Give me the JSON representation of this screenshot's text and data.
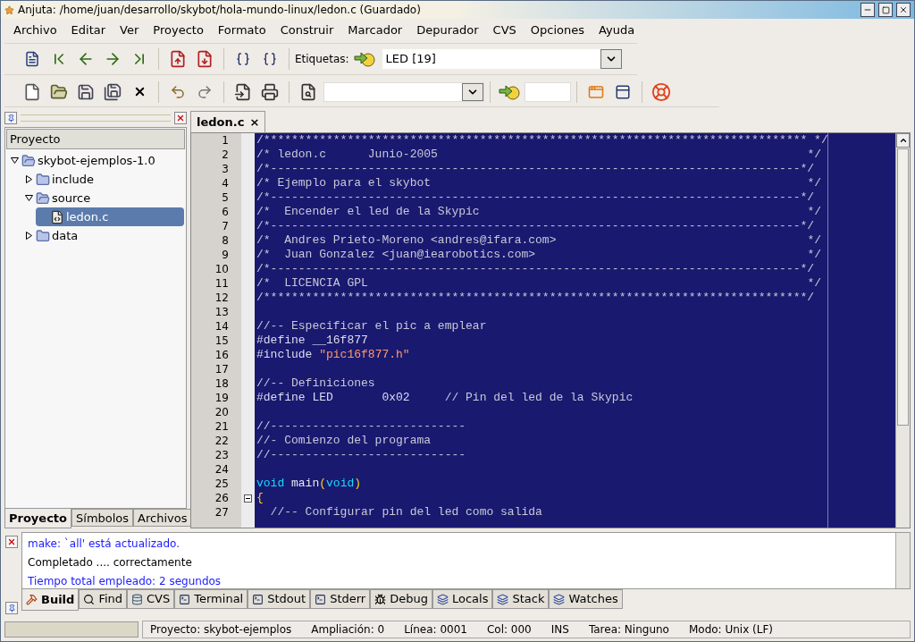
{
  "window": {
    "title": "Anjuta: /home/juan/desarrollo/skybot/hola-mundo-linux/ledon.c (Guardado)"
  },
  "menu": [
    "Archivo",
    "Editar",
    "Ver",
    "Proyecto",
    "Formato",
    "Construir",
    "Marcador",
    "Depurador",
    "CVS",
    "Opciones",
    "Ayuda"
  ],
  "tag_bar": {
    "label": "Etiquetas:",
    "value": "LED [19]"
  },
  "project_panel": {
    "header": "Proyecto",
    "tree": [
      {
        "label": "skybot-ejemplos-1.0",
        "kind": "folder",
        "expanded": true,
        "selected": false,
        "children": [
          {
            "label": "include",
            "kind": "folder",
            "expanded": false,
            "selected": false
          },
          {
            "label": "source",
            "kind": "folder",
            "expanded": true,
            "selected": false,
            "children": [
              {
                "label": "ledon.c",
                "kind": "file",
                "selected": true
              }
            ]
          },
          {
            "label": "data",
            "kind": "folder",
            "expanded": false,
            "selected": false
          }
        ]
      }
    ],
    "tabs": [
      {
        "label": "Proyecto",
        "selected": true
      },
      {
        "label": "Símbolos",
        "selected": false
      },
      {
        "label": "Archivos",
        "selected": false
      }
    ]
  },
  "editor": {
    "tabs": [
      {
        "label": "ledon.c",
        "close": "×",
        "selected": true
      }
    ],
    "lines": [
      {
        "num": "1",
        "tokens": [
          {
            "kind": "comment",
            "text": "/****************************************************************************** */"
          }
        ]
      },
      {
        "num": "2",
        "tokens": [
          {
            "kind": "comment",
            "text": "/* ledon.c      Junio-2005"
          }
        ],
        "end": "*/"
      },
      {
        "num": "3",
        "tokens": [
          {
            "kind": "comment",
            "text": "/*----------------------------------------------------------------------------*/"
          }
        ]
      },
      {
        "num": "4",
        "tokens": [
          {
            "kind": "comment",
            "text": "/* Ejemplo para el skybot"
          }
        ],
        "end": "*/"
      },
      {
        "num": "5",
        "tokens": [
          {
            "kind": "comment",
            "text": "/*----------------------------------------------------------------------------*/"
          }
        ]
      },
      {
        "num": "6",
        "tokens": [
          {
            "kind": "comment",
            "text": "/*  Encender el led de la Skypic"
          }
        ],
        "end": "*/"
      },
      {
        "num": "7",
        "tokens": [
          {
            "kind": "comment",
            "text": "/*----------------------------------------------------------------------------*/"
          }
        ]
      },
      {
        "num": "8",
        "tokens": [
          {
            "kind": "comment",
            "text": "/*  Andres Prieto-Moreno <andres@ifara.com>"
          }
        ],
        "end": "*/"
      },
      {
        "num": "9",
        "tokens": [
          {
            "kind": "comment",
            "text": "/*  Juan Gonzalez <juan@iearobotics.com>"
          }
        ],
        "end": "*/"
      },
      {
        "num": "10",
        "tokens": [
          {
            "kind": "comment",
            "text": "/*----------------------------------------------------------------------------*/"
          }
        ]
      },
      {
        "num": "11",
        "tokens": [
          {
            "kind": "comment",
            "text": "/*  LICENCIA GPL"
          }
        ],
        "end": "*/"
      },
      {
        "num": "12",
        "tokens": [
          {
            "kind": "comment",
            "text": "/******************************************************************************/"
          }
        ]
      },
      {
        "num": "13"
      },
      {
        "num": "14",
        "tokens": [
          {
            "kind": "comment",
            "text": "//-- Especificar el pic a emplear"
          }
        ]
      },
      {
        "num": "15",
        "tokens": [
          {
            "kind": "preprocessor",
            "text": "#define __16f877"
          }
        ]
      },
      {
        "num": "16",
        "tokens": [
          {
            "kind": "preprocessor",
            "text": "#include "
          },
          {
            "kind": "string",
            "text": "\"pic16f877.h\""
          }
        ]
      },
      {
        "num": "17"
      },
      {
        "num": "18",
        "tokens": [
          {
            "kind": "comment",
            "text": "//-- Definiciones"
          }
        ]
      },
      {
        "num": "19",
        "tokens": [
          {
            "kind": "preprocessor",
            "text": "#define LED       0x02     "
          },
          {
            "kind": "comment",
            "text": "// Pin del led de la Skypic"
          }
        ]
      },
      {
        "num": "20"
      },
      {
        "num": "21",
        "tokens": [
          {
            "kind": "comment",
            "text": "//----------------------------"
          }
        ]
      },
      {
        "num": "22",
        "tokens": [
          {
            "kind": "comment",
            "text": "//- Comienzo del programa"
          }
        ]
      },
      {
        "num": "23",
        "tokens": [
          {
            "kind": "comment",
            "text": "//----------------------------"
          }
        ]
      },
      {
        "num": "24"
      },
      {
        "num": "25",
        "tokens": [
          {
            "kind": "keyword",
            "text": "void"
          },
          {
            "kind": "plain",
            "text": " main"
          },
          {
            "kind": "brace",
            "text": "("
          },
          {
            "kind": "keyword",
            "text": "void"
          },
          {
            "kind": "brace",
            "text": ")"
          }
        ]
      },
      {
        "num": "26",
        "fold": true,
        "tokens": [
          {
            "kind": "brace",
            "text": "{"
          }
        ]
      },
      {
        "num": "27",
        "tokens": [
          {
            "kind": "comment",
            "text": "  //-- Configurar pin del led como salida"
          }
        ]
      }
    ]
  },
  "messages": [
    {
      "text": "make: `all' está actualizado.",
      "color": "#1a1aff"
    },
    {
      "text": "Completado .... correctamente",
      "color": "#000000"
    },
    {
      "text": "Tiempo total empleado: 2 segundos",
      "color": "#1a1aff"
    }
  ],
  "message_tabs": [
    {
      "label": "Build",
      "kind": "build",
      "selected": true
    },
    {
      "label": "Find",
      "kind": "find",
      "selected": false
    },
    {
      "label": "CVS",
      "kind": "cvs",
      "selected": false
    },
    {
      "label": "Terminal",
      "kind": "terminal",
      "selected": false
    },
    {
      "label": "Stdout",
      "kind": "terminal",
      "selected": false
    },
    {
      "label": "Stderr",
      "kind": "terminal",
      "selected": false
    },
    {
      "label": "Debug",
      "kind": "debug",
      "selected": false
    },
    {
      "label": "Locals",
      "kind": "watch",
      "selected": false
    },
    {
      "label": "Stack",
      "kind": "watch",
      "selected": false
    },
    {
      "label": "Watches",
      "kind": "watch",
      "selected": false
    }
  ],
  "status_bar": [
    "Proyecto: skybot-ejemplos",
    "Ampliación: 0",
    "Línea: 0001",
    "Col: 000",
    "INS",
    "Tarea: Ninguno",
    "Modo: Unix (LF)"
  ]
}
